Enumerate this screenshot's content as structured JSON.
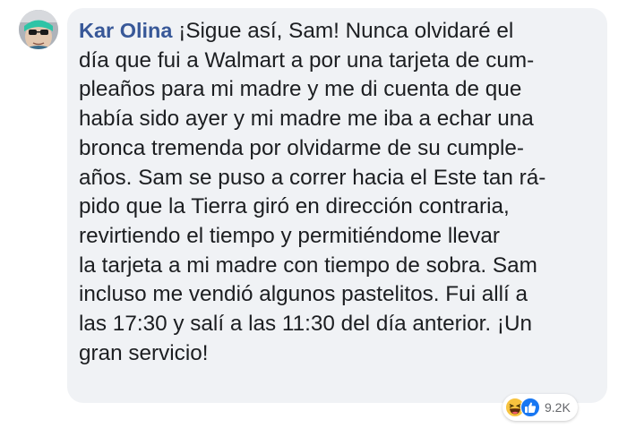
{
  "comment": {
    "author": "Kar Olina",
    "text_lines": [
      " ¡Sigue así, Sam! Nunca olvidaré el",
      "día que fui a Walmart a por una tarjeta de cum-",
      "pleaños para mi madre y me di cuenta de que",
      "había sido ayer y mi madre me iba a echar una",
      "bronca tremenda por olvidarme de su cumple-",
      "años. Sam se puso a correr hacia el Este tan rá-",
      "pido que la Tierra giró en dirección contraria,",
      "revirtiendo el tiempo y permitiéndome llevar",
      "la tarjeta a mi madre con tiempo de sobra. Sam",
      "incluso me vendió algunos pastelitos. Fui allí a",
      "las 17:30 y salí a las 11:30 del día anterior. ¡Un",
      "gran servicio!"
    ]
  },
  "reactions": {
    "icons": [
      "haha-icon",
      "like-icon"
    ],
    "count": "9.2K"
  },
  "colors": {
    "bubble_bg": "#f0f2f5",
    "author_link": "#385898",
    "text": "#1c1e21",
    "like_blue": "#1877f2",
    "haha_yellow": "#f7c33f"
  }
}
